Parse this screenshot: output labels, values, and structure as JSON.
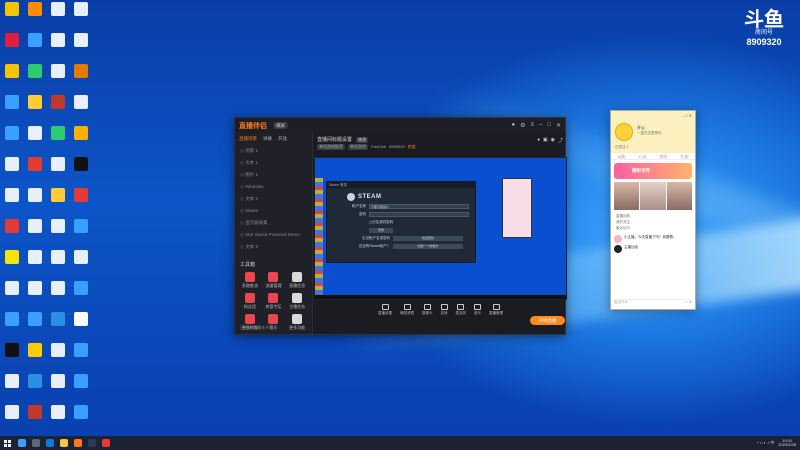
{
  "watermark": {
    "logo": "斗鱼",
    "room_label": "房间号",
    "room_number": "8909320"
  },
  "desktop_icons": [
    {
      "label": "",
      "color": "#f5c400"
    },
    {
      "label": "",
      "color": "#ff8c00"
    },
    {
      "label": "",
      "color": "#e8f0ff"
    },
    {
      "label": "",
      "color": "#e8f0ff"
    },
    {
      "label": "",
      "color": "#e01e3c"
    },
    {
      "label": "",
      "color": "#3aa0ff"
    },
    {
      "label": "",
      "color": "#e8f0ff"
    },
    {
      "label": "",
      "color": "#e8f0ff"
    },
    {
      "label": "",
      "color": "#f5c400"
    },
    {
      "label": "",
      "color": "#2ecc71"
    },
    {
      "label": "",
      "color": "#e8f0ff"
    },
    {
      "label": "",
      "color": "#e07b00"
    },
    {
      "label": "",
      "color": "#3aa0ff"
    },
    {
      "label": "",
      "color": "#ffcc33"
    },
    {
      "label": "",
      "color": "#c0392b"
    },
    {
      "label": "",
      "color": "#e8f0ff"
    },
    {
      "label": "",
      "color": "#3aa0ff"
    },
    {
      "label": "",
      "color": "#e8f0ff"
    },
    {
      "label": "",
      "color": "#2ecc71"
    },
    {
      "label": "",
      "color": "#ffb000"
    },
    {
      "label": "",
      "color": "#e8f0ff"
    },
    {
      "label": "",
      "color": "#e53935"
    },
    {
      "label": "",
      "color": "#e8f0ff"
    },
    {
      "label": "",
      "color": "#111"
    },
    {
      "label": "",
      "color": "#e8f0ff"
    },
    {
      "label": "",
      "color": "#e8f0ff"
    },
    {
      "label": "",
      "color": "#ffcc33"
    },
    {
      "label": "",
      "color": "#e53935"
    },
    {
      "label": "",
      "color": "#e53935"
    },
    {
      "label": "",
      "color": "#e8f0ff"
    },
    {
      "label": "",
      "color": "#e8f0ff"
    },
    {
      "label": "",
      "color": "#3aa0ff"
    },
    {
      "label": "",
      "color": "#f5e400"
    },
    {
      "label": "",
      "color": "#e8f0ff"
    },
    {
      "label": "",
      "color": "#e8f0ff"
    },
    {
      "label": "",
      "color": "#e8f0ff"
    },
    {
      "label": "",
      "color": "#e8f0ff"
    },
    {
      "label": "",
      "color": "#e8f0ff"
    },
    {
      "label": "",
      "color": "#e8f0ff"
    },
    {
      "label": "",
      "color": "#3aa0ff"
    },
    {
      "label": "",
      "color": "#3aa0ff"
    },
    {
      "label": "",
      "color": "#3aa0ff"
    },
    {
      "label": "",
      "color": "#2b8fe6"
    },
    {
      "label": "",
      "color": "#ffffff"
    },
    {
      "label": "",
      "color": "#111"
    },
    {
      "label": "",
      "color": "#ffcc00"
    },
    {
      "label": "",
      "color": "#e8f0ff"
    },
    {
      "label": "",
      "color": "#3aa0ff"
    },
    {
      "label": "",
      "color": "#e8f0ff"
    },
    {
      "label": "",
      "color": "#2b8fe6"
    },
    {
      "label": "",
      "color": "#e8f0ff"
    },
    {
      "label": "",
      "color": "#3aa0ff"
    },
    {
      "label": "",
      "color": "#e8f0ff"
    },
    {
      "label": "",
      "color": "#c0392b"
    },
    {
      "label": "",
      "color": "#e8f0ff"
    },
    {
      "label": "",
      "color": "#3aa0ff"
    }
  ],
  "app": {
    "brand": "直播伴侣",
    "mode": "横屏",
    "tabs": [
      "直播场景",
      "弹幕",
      "开放"
    ],
    "scenes": [
      "场景 1",
      "文本 1",
      "图片 1",
      "Windows",
      "文本 2",
      "Steam",
      "显示器采集",
      "Star Savior Powered Demo",
      "文本 3"
    ],
    "toolbox_title": "工具箱",
    "tools": [
      "多路推流",
      "流量管理",
      "直播信息",
      "粉丝团",
      "房管专区",
      "主播任务",
      "更多特效",
      "音乐",
      "更多功能"
    ],
    "status": "已连接 直播未开始",
    "room_title": "直播间标题设置",
    "edit_label": "修改",
    "tags": [
      "单机游戏推荐",
      "单机游戏",
      "FanClub",
      "8909320",
      "热度"
    ],
    "steam": {
      "titlebar": "Steam 登录",
      "brand": "STEAM",
      "account_label": "帐户名称",
      "account_value": "不要不要用户",
      "password_label": "密码",
      "remember_label": "记住我的密码",
      "login_button": "登录",
      "forgot_label": "忘记帐户名或密码",
      "forgot_button": "找回密码",
      "create_label": "还没有Steam帐户？",
      "create_button": "创建一个新帐户"
    },
    "dock": [
      "直播设置",
      "美颜滤镜",
      "摄像头",
      "游戏",
      "麦克风",
      "音乐",
      "直播管理"
    ],
    "start_button": "开始直播"
  },
  "phone": {
    "name": "开心",
    "subtitle": "一直在这里等你",
    "group": "已关注 1",
    "tabs": [
      "动态",
      "心动",
      "房间",
      "礼物"
    ],
    "banner": "精彩世界",
    "list": [
      "直播回放",
      "我的关注",
      "最近访问"
    ],
    "messages": [
      {
        "text": "小主播，今天直播了吗？我要看。"
      },
      {
        "text": "主播加油"
      }
    ],
    "input": "说点什么"
  },
  "taskbar": {
    "time": "19:31",
    "date": "2023/2/28"
  }
}
